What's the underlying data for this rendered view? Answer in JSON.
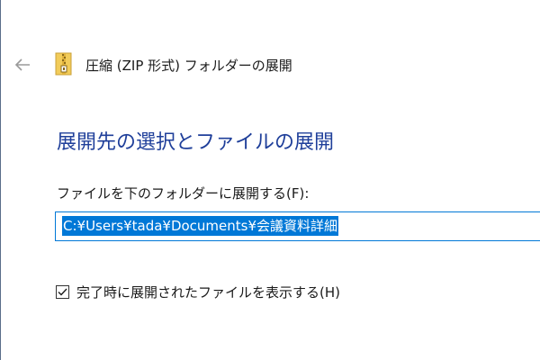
{
  "header": {
    "title": "圧縮 (ZIP 形式) フォルダーの展開",
    "back_icon": "back-arrow-icon",
    "folder_icon": "zip-folder-icon"
  },
  "main": {
    "heading": "展開先の選択とファイルの展開",
    "destination": {
      "label": "ファイルを下のフォルダーに展開する(F):",
      "value": "C:¥Users¥tada¥Documents¥会議資料詳細"
    },
    "show_files_checkbox": {
      "label": "完了時に展開されたファイルを表示する(H)",
      "checked": true
    }
  },
  "colors": {
    "heading": "#1f3f9a",
    "selection": "#0078d7",
    "input_border": "#0078d7"
  }
}
